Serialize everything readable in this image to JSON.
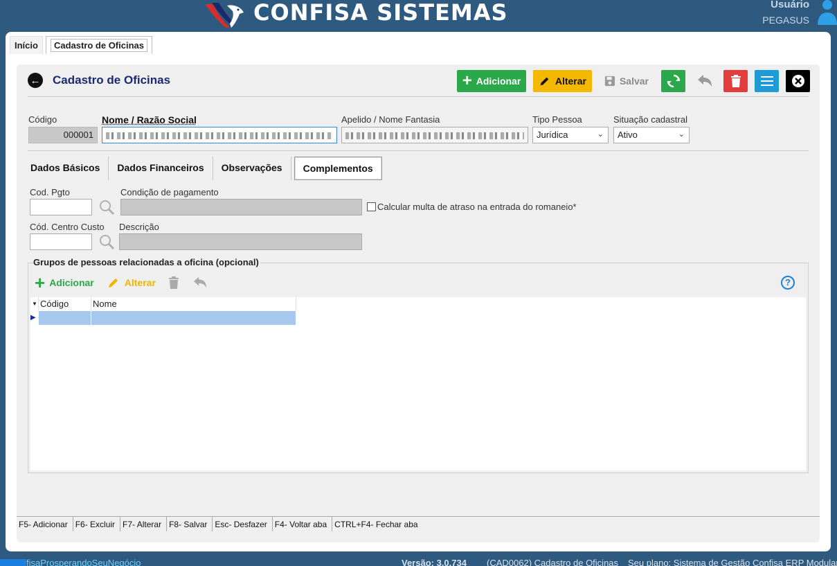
{
  "header": {
    "brand": "CONFISA SISTEMAS",
    "user_label": "Usuário",
    "user_name": "PEGASUS"
  },
  "top_tabs": [
    {
      "label": "Início"
    },
    {
      "label": "Cadastro de Oficinas"
    }
  ],
  "page": {
    "title": "Cadastro de Oficinas",
    "toolbar": {
      "add": "Adicionar",
      "edit": "Alterar",
      "save": "Salvar"
    }
  },
  "form": {
    "codigo_label": "Código",
    "codigo_value": "000001",
    "nome_label": "Nome / Razão Social",
    "apelido_label": "Apelido / Nome Fantasia",
    "tipo_label": "Tipo Pessoa",
    "tipo_value": "Jurídica",
    "situacao_label": "Situação cadastral",
    "situacao_value": "Ativo"
  },
  "inner_tabs": [
    {
      "label": "Dados Básicos"
    },
    {
      "label": "Dados Financeiros"
    },
    {
      "label": "Observações"
    },
    {
      "label": "Complementos"
    }
  ],
  "complementos": {
    "cod_pgto_label": "Cod. Pgto",
    "condicao_label": "Condição de pagamento",
    "multa_label": "Calcular multa de atraso na entrada do romaneio*",
    "centro_custo_label": "Cód. Centro Custo",
    "descricao_label": "Descrição"
  },
  "group": {
    "title": "Grupos de pessoas relacionadas a oficina (opcional)",
    "add": "Adicionar",
    "edit": "Alterar",
    "help": "?",
    "columns": [
      "Código",
      "Nome"
    ]
  },
  "shortcuts": [
    "F5- Adicionar",
    "F6- Excluir",
    "F7- Alterar",
    "F8- Salvar",
    "Esc- Desfazer",
    "F4- Voltar aba",
    "CTRL+F4- Fechar aba"
  ],
  "status": {
    "link": "fisaProsperandoSeuNegócio",
    "version": "Versão: 3.0.734",
    "screen": "(CAD0062) Cadastro de Oficinas",
    "plan": "Seu plano: Sistema de Gestão Confisa ERP Modular"
  },
  "colors": {
    "background": "#2f5a80",
    "add": "#2aa84a",
    "edit": "#f5b800",
    "delete": "#e23c3c",
    "menu": "#1e9ad6",
    "title": "#1a2a6c",
    "row_selected": "#a7c8ee"
  }
}
